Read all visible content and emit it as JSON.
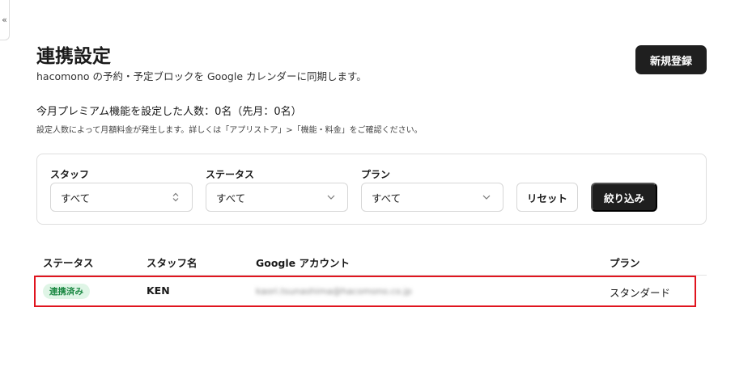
{
  "sidebar_toggle": {
    "label": "«"
  },
  "header": {
    "title": "連携設定",
    "subtitle": "hacomono の予約・予定ブロックを Google カレンダーに同期します。",
    "new_button": "新規登録"
  },
  "premium": {
    "count_text": "今月プレミアム機能を設定した人数：0名（先月：0名）",
    "note": "設定人数によって月額料金が発生します。詳しくは「アプリストア」>「機能・料金」をご確認ください。"
  },
  "filters": {
    "staff": {
      "label": "スタッフ",
      "value": "すべて"
    },
    "status": {
      "label": "ステータス",
      "value": "すべて"
    },
    "plan": {
      "label": "プラン",
      "value": "すべて"
    },
    "reset_label": "リセット",
    "apply_label": "絞り込み"
  },
  "table": {
    "headers": {
      "status": "ステータス",
      "staff": "スタッフ名",
      "google": "Google アカウント",
      "plan": "プラン"
    },
    "rows": [
      {
        "status": "連携済み",
        "staff": "KEN",
        "google": "kaori.tsunashima@hacomono.co.jp",
        "plan": "スタンダード"
      }
    ]
  },
  "colors": {
    "primary_button": "#1f1f1f",
    "badge_bg": "#dff5e6",
    "badge_text": "#1e8a45",
    "highlight": "#e0141e"
  }
}
